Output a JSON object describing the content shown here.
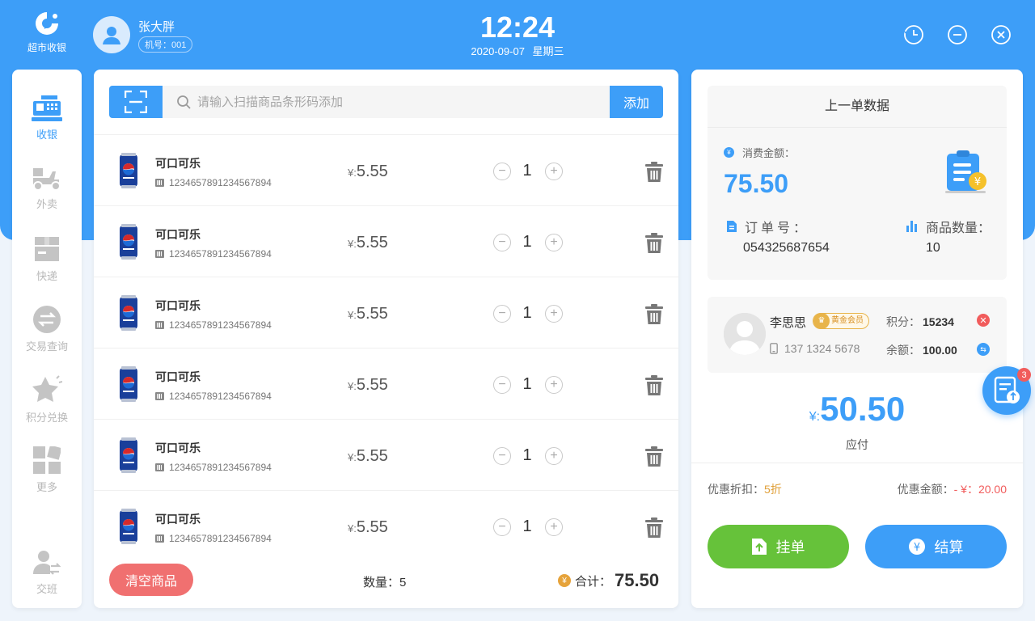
{
  "app": {
    "name": "超市收银"
  },
  "user": {
    "name": "张大胖",
    "machine": "机号：001"
  },
  "clock": {
    "time": "12:24",
    "date": "2020-09-07",
    "weekday": "星期三"
  },
  "header_icons": [
    "history-icon",
    "minimize-icon",
    "close-icon"
  ],
  "sidebar": {
    "items": [
      {
        "label": "收银",
        "icon": "cash-register-icon",
        "active": true
      },
      {
        "label": "外卖",
        "icon": "delivery-scooter-icon",
        "active": false
      },
      {
        "label": "快递",
        "icon": "package-box-icon",
        "active": false
      },
      {
        "label": "交易查询",
        "icon": "exchange-icon",
        "active": false
      },
      {
        "label": "积分兑换",
        "icon": "star-icon",
        "active": false
      },
      {
        "label": "更多",
        "icon": "grid-icon",
        "active": false
      },
      {
        "label": "交班",
        "icon": "shift-handover-icon",
        "active": false
      }
    ]
  },
  "search": {
    "placeholder": "请输入扫描商品条形码添加",
    "value": "",
    "add_label": "添加"
  },
  "cart": {
    "items": [
      {
        "name": "可口可乐",
        "code": "1234657891234567894",
        "currency": "¥:",
        "price": "5.55",
        "qty": "1"
      },
      {
        "name": "可口可乐",
        "code": "1234657891234567894",
        "currency": "¥:",
        "price": "5.55",
        "qty": "1"
      },
      {
        "name": "可口可乐",
        "code": "1234657891234567894",
        "currency": "¥:",
        "price": "5.55",
        "qty": "1"
      },
      {
        "name": "可口可乐",
        "code": "1234657891234567894",
        "currency": "¥:",
        "price": "5.55",
        "qty": "1"
      },
      {
        "name": "可口可乐",
        "code": "1234657891234567894",
        "currency": "¥:",
        "price": "5.55",
        "qty": "1"
      },
      {
        "name": "可口可乐",
        "code": "1234657891234567894",
        "currency": "¥:",
        "price": "5.55",
        "qty": "1"
      }
    ],
    "clear_label": "清空商品",
    "count_text": "数量：5",
    "total_label": "合计：",
    "total_value": "75.50"
  },
  "last_order": {
    "title": "上一单数据",
    "consume_label": "消费金额：",
    "consume_amount": "75.50",
    "order_label": "订单号：",
    "order_no": "054325687654",
    "qty_label": "商品数量：",
    "qty_value": "10"
  },
  "member": {
    "name": "李思思",
    "level": "黄金会员",
    "phone": "137 1324 5678",
    "points_label": "积分：",
    "points": "15234",
    "balance_label": "余额：",
    "balance": "100.00"
  },
  "float_badge": "3",
  "payment": {
    "currency": "¥:",
    "amount": "50.50",
    "label": "应付",
    "discount_label": "优惠折扣：",
    "discount": "5折",
    "discount_amount_label": "优惠金额：",
    "discount_amount": "- ¥：20.00",
    "hold_label": "挂单",
    "settle_label": "结算"
  },
  "colors": {
    "primary": "#3d9ef8",
    "green": "#66c23a",
    "red": "#f07070",
    "gold": "#e6a33b"
  }
}
